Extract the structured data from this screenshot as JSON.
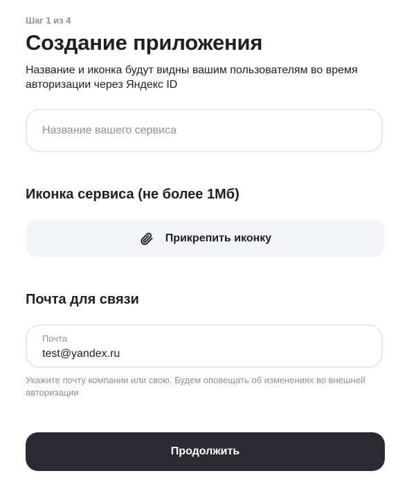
{
  "step": "Шаг 1 из 4",
  "title": "Создание приложения",
  "subtitle": "Название и иконка будут видны вашим пользователям во время авторизации через Яндекс ID",
  "name_field": {
    "placeholder": "Название вашего сервиса",
    "value": ""
  },
  "icon_section": {
    "title": "Иконка сервиса (не более 1Мб)",
    "attach_label": "Прикрепить иконку",
    "attach_icon": "paperclip-icon"
  },
  "email_section": {
    "title": "Почта для связи",
    "field_label": "Почта",
    "value": "test@yandex.ru",
    "hint": "Укажите почту компании или свою. Будем оповещать об изменениях во внешней авторизации"
  },
  "continue_label": "Продолжить",
  "colors": {
    "text": "#21201f",
    "muted": "#8d8f99",
    "field_border": "#e7e8ec",
    "secondary_button_bg": "#f3f4f7",
    "primary_button_bg": "#2b2a33",
    "primary_button_text": "#ffffff"
  }
}
